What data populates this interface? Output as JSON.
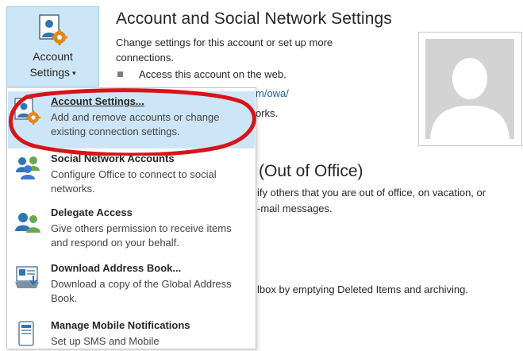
{
  "account_settings_button": {
    "label_line1": "Account",
    "label_line2": "Settings",
    "caret": "▾"
  },
  "page": {
    "title": "Account and Social Network Settings",
    "description": "Change settings for this account or set up more connections.",
    "bullet": "Access this account on the web.",
    "link_fragment": "m/owa/",
    "works_fragment": "orks.",
    "ooo_title_fragment": "(Out of Office)",
    "ooo_desc_line1": "ify others that you are out of office, on vacation, or",
    "ooo_desc_line2": "-mail messages.",
    "cleanup_desc_fragment": "lbox by emptying Deleted Items and archiving."
  },
  "menu": {
    "items": [
      {
        "title": "Account Settings...",
        "desc": "Add and remove accounts or change existing connection settings.",
        "icon": "account-settings-icon",
        "highlighted": true
      },
      {
        "title": "Social Network Accounts",
        "desc": "Configure Office to connect to social networks.",
        "icon": "social-network-icon",
        "highlighted": false
      },
      {
        "title": "Delegate Access",
        "desc": "Give others permission to receive items and respond on your behalf.",
        "icon": "delegate-access-icon",
        "highlighted": false
      },
      {
        "title": "Download Address Book...",
        "desc": "Download a copy of the Global Address Book.",
        "icon": "address-book-icon",
        "highlighted": false
      },
      {
        "title": "Manage Mobile Notifications",
        "desc": "Set up SMS and Mobile",
        "icon": "mobile-notifications-icon",
        "highlighted": false
      }
    ]
  },
  "colors": {
    "highlight": "#cde6f7",
    "annotation_red": "#d8141b",
    "link": "#1f5fa6"
  }
}
